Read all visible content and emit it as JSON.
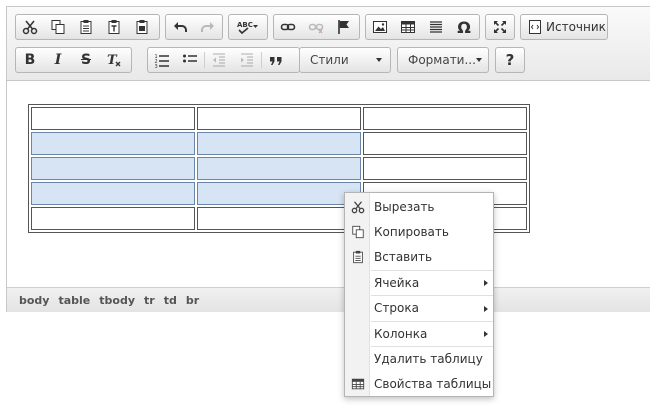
{
  "toolbar": {
    "source_label": "Источник",
    "styles_combo": "Стили",
    "format_combo": "Формати...",
    "help_label": "?"
  },
  "icons": {
    "cut": "scissors-icon",
    "copy": "copy-icon",
    "paste": "clipboard-icon",
    "paste_text": "paste-text-icon",
    "paste_word": "paste-word-icon",
    "undo": "undo-icon",
    "redo": "redo-icon",
    "spellcheck": "spellcheck-icon",
    "link": "link-icon",
    "unlink": "unlink-icon",
    "anchor": "flag-icon",
    "image": "image-icon",
    "table": "table-icon",
    "hr": "horizontal-rule-icon",
    "special_char": "omega-icon",
    "maximize": "maximize-icon",
    "source": "source-icon"
  },
  "format_buttons": {
    "bold": "B",
    "italic": "I",
    "strike": "S",
    "remove_format": "T"
  },
  "spell_label": "ABC",
  "special_char_glyph": "Ω",
  "statusbar": {
    "path": [
      "body",
      "table",
      "tbody",
      "tr",
      "td",
      "br"
    ]
  },
  "table": {
    "rows": 5,
    "cols": 3,
    "selected": [
      [
        1,
        0
      ],
      [
        1,
        1
      ],
      [
        2,
        0
      ],
      [
        2,
        1
      ],
      [
        3,
        0
      ],
      [
        3,
        1
      ]
    ]
  },
  "context_menu": {
    "items": [
      {
        "label": "Вырезать",
        "icon": "scissors-icon",
        "submenu": false
      },
      {
        "label": "Копировать",
        "icon": "copy-icon",
        "submenu": false
      },
      {
        "label": "Вставить",
        "icon": "clipboard-icon",
        "submenu": false
      },
      {
        "label": "Ячейка",
        "icon": "",
        "submenu": true
      },
      {
        "label": "Строка",
        "icon": "",
        "submenu": true
      },
      {
        "label": "Колонка",
        "icon": "",
        "submenu": true
      },
      {
        "label": "Удалить таблицу",
        "icon": "",
        "submenu": false
      },
      {
        "label": "Свойства таблицы",
        "icon": "table-icon",
        "submenu": false
      }
    ]
  },
  "colors": {
    "selected_cell": "#d6e4f4",
    "toolbar_bg": "#e9e9e9"
  }
}
